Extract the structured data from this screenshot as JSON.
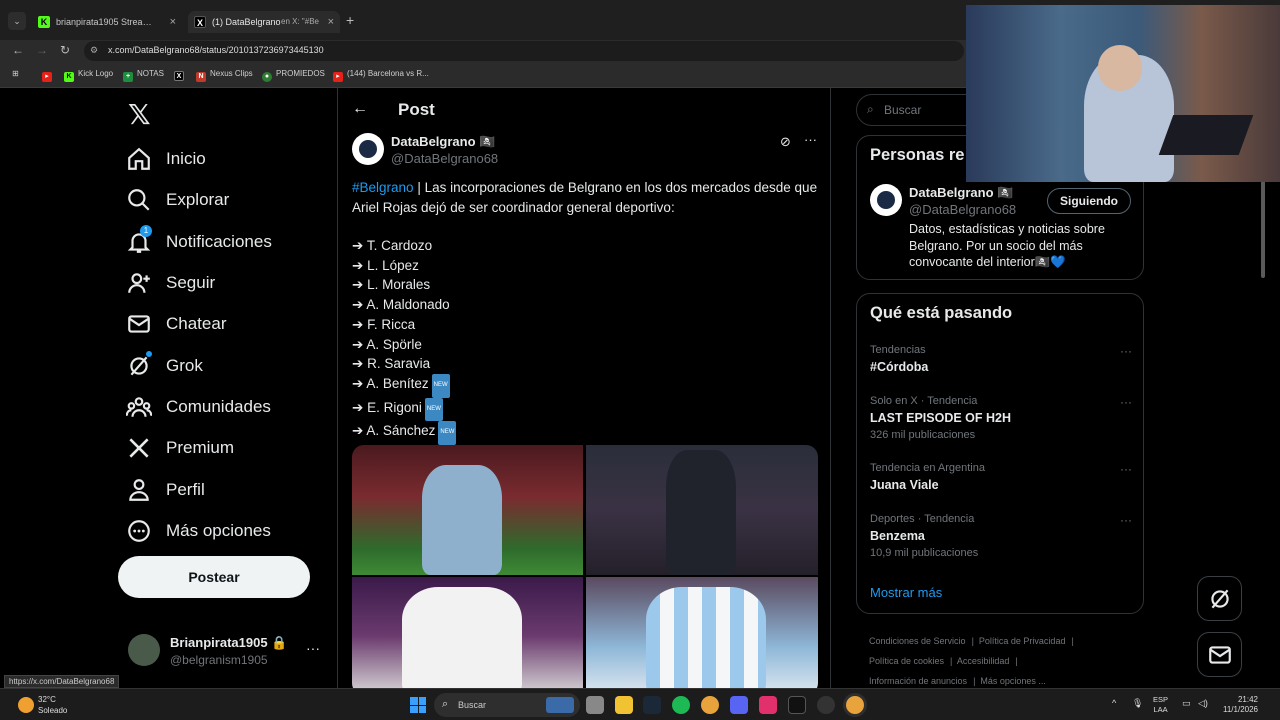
{
  "browser": {
    "tabs": [
      {
        "title": "brianpirata1905 Stream - Watch",
        "favicon": "kick"
      },
      {
        "title": "(1) DataBelgrano",
        "suffix": "en X: \"#Be",
        "favicon": "x"
      }
    ],
    "url": "x.com/DataBelgrano68/status/2010137236973445130",
    "bookmarks": [
      "Kick Logo",
      "NOTAS",
      "Nexus Clips",
      "PROMIEDOS",
      "(144) Barcelona vs R..."
    ],
    "status_url": "https://x.com/DataBelgrano68"
  },
  "nav": {
    "items": [
      {
        "label": "Inicio",
        "icon": "home-icon"
      },
      {
        "label": "Explorar",
        "icon": "search-icon"
      },
      {
        "label": "Notificaciones",
        "icon": "bell-icon",
        "badge": "1"
      },
      {
        "label": "Seguir",
        "icon": "person-plus-icon"
      },
      {
        "label": "Chatear",
        "icon": "mail-icon"
      },
      {
        "label": "Grok",
        "icon": "grok-icon"
      },
      {
        "label": "Comunidades",
        "icon": "communities-icon"
      },
      {
        "label": "Premium",
        "icon": "x-icon"
      },
      {
        "label": "Perfil",
        "icon": "person-icon"
      },
      {
        "label": "Más opciones",
        "icon": "more-circle-icon"
      }
    ],
    "post_button": "Postear",
    "account": {
      "name": "Brianpirata1905",
      "handle": "@belgranism1905"
    }
  },
  "post": {
    "header": "Post",
    "author_name": "DataBelgrano",
    "author_emoji": "🏴‍☠️",
    "author_handle": "@DataBelgrano68",
    "hashtag": "#Belgrano",
    "text": " | Las incorporaciones de Belgrano en los dos mercados desde que Ariel Rojas dejó de ser coordinador general deportivo:",
    "players": [
      {
        "name": "T. Cardozo",
        "new": false
      },
      {
        "name": "L. López",
        "new": false
      },
      {
        "name": "L. Morales",
        "new": false
      },
      {
        "name": "A. Maldonado",
        "new": false
      },
      {
        "name": "F. Ricca",
        "new": false
      },
      {
        "name": "A. Spörle",
        "new": false
      },
      {
        "name": "R. Saravia",
        "new": false
      },
      {
        "name": "A. Benítez",
        "new": true
      },
      {
        "name": "E. Rigoni",
        "new": true
      },
      {
        "name": "A. Sánchez",
        "new": true
      }
    ],
    "arrow": "➔",
    "new_label": "NEW"
  },
  "sidebar": {
    "search_placeholder": "Buscar",
    "relevant_title": "Personas re",
    "relevant": {
      "name": "DataBelgrano",
      "handle": "@DataBelgrano68",
      "follow_label": "Siguiendo",
      "bio": "Datos, estadísticas y noticias sobre Belgrano. Por un socio del más convocante del interior🏴‍☠️💙"
    },
    "trends_title": "Qué está pasando",
    "trends": [
      {
        "context": "Tendencias",
        "name": "#Córdoba",
        "count": ""
      },
      {
        "context": "Solo en X · Tendencia",
        "name": "LAST EPISODE OF H2H",
        "count": "326 mil publicaciones"
      },
      {
        "context": "Tendencia en Argentina",
        "name": "Juana Viale",
        "count": ""
      },
      {
        "context": "Deportes · Tendencia",
        "name": "Benzema",
        "count": "10,9 mil publicaciones"
      }
    ],
    "show_more": "Mostrar más",
    "footer": [
      "Condiciones de Servicio",
      "Política de Privacidad",
      "Política de cookies",
      "Accesibilidad",
      "Información de anuncios",
      "Más opciones ..."
    ]
  },
  "taskbar": {
    "temp": "32°C",
    "weather": "Soleado",
    "search": "Buscar",
    "lang1": "ESP",
    "lang2": "LAA",
    "time": "21:42",
    "date": "11/1/2026"
  }
}
